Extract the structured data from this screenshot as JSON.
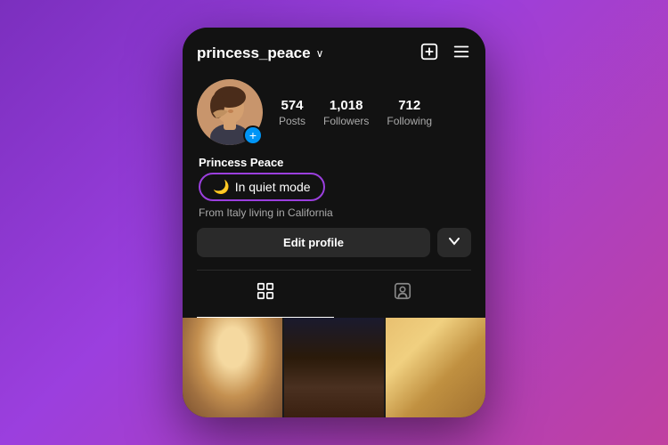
{
  "header": {
    "username": "princess_peace",
    "username_chevron": "∨"
  },
  "icons": {
    "plus_square": "⊞",
    "menu": "≡",
    "add_story": "+",
    "moon": "🌙",
    "grid": "⊞",
    "person_tag": "⊟"
  },
  "stats": {
    "posts_count": "574",
    "posts_label": "Posts",
    "followers_count": "1,018",
    "followers_label": "Followers",
    "following_count": "712",
    "following_label": "Following"
  },
  "profile": {
    "display_name": "Princess Peace",
    "quiet_mode_text": "In quiet mode",
    "bio": "From Italy living in California"
  },
  "actions": {
    "edit_profile": "Edit profile",
    "dropdown_arrow": "∨"
  }
}
